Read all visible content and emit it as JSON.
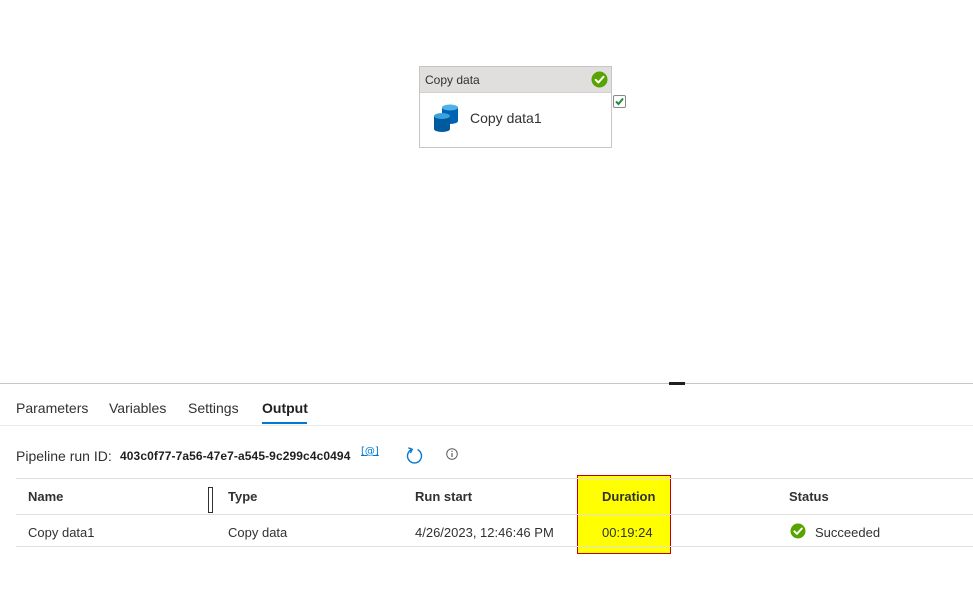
{
  "canvas": {
    "activity": {
      "type_label": "Copy data",
      "name": "Copy data1",
      "header_status_icon": "check-circle-icon",
      "activity_icon": "database-icon",
      "success_port_icon": "checkbox-check-icon"
    }
  },
  "tabs": [
    {
      "label": "Parameters",
      "active": false
    },
    {
      "label": "Variables",
      "active": false
    },
    {
      "label": "Settings",
      "active": false
    },
    {
      "label": "Output",
      "active": true
    }
  ],
  "output": {
    "run_id_label": "Pipeline run ID:",
    "run_id_value": "403c0f77-7a56-47e7-a545-9c299c4c0494",
    "copy_icon_glyph": "[@]",
    "refresh_icon": "refresh-icon",
    "info_icon": "info-icon",
    "table": {
      "columns": [
        "Name",
        "Type",
        "Run start",
        "Duration",
        "Status"
      ],
      "rows": [
        {
          "name": "Copy data1",
          "type": "Copy data",
          "run_start": "4/26/2023, 12:46:46 PM",
          "duration": "00:19:24",
          "status": "Succeeded",
          "status_icon": "check-circle-icon"
        }
      ]
    },
    "highlighted_column": "Duration"
  },
  "colors": {
    "accent": "#0078d4",
    "success": "#57a300",
    "highlight_fill": "#ffff00",
    "highlight_border": "#c00000",
    "db_icon": "#0063b1"
  }
}
